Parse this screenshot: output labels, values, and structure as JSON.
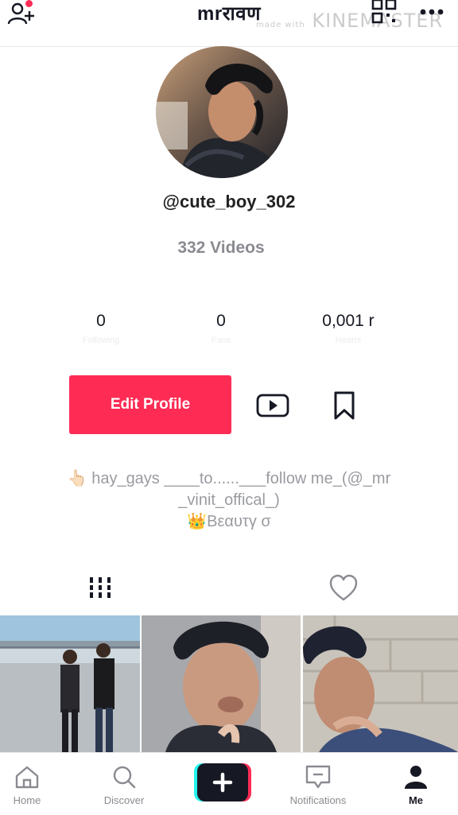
{
  "header": {
    "title": "mrरावण",
    "watermark": "KINEMASTER",
    "watermark_small": "made with"
  },
  "profile": {
    "username": "@cute_boy_302",
    "video_count": "332 Videos"
  },
  "stats": [
    {
      "value": "0",
      "label": "Following"
    },
    {
      "value": "0",
      "label": "Fans"
    },
    {
      "value": "0,001 r",
      "label": "Hearts"
    }
  ],
  "actions": {
    "edit_profile": "Edit Profile"
  },
  "bio": {
    "line1": "👆🏻 hay_gays ____to......___follow me_(@_mr",
    "line2": "_vinit_offical_)",
    "line3": "👑Bεαυτγ σ"
  },
  "nav": {
    "home": "Home",
    "discover": "Discover",
    "notifications": "Notifications",
    "me": "Me"
  },
  "colors": {
    "accent": "#fe2c55",
    "plus_cyan": "#25f4ee",
    "text_dark": "#161823",
    "text_gray": "#8a8b91"
  }
}
